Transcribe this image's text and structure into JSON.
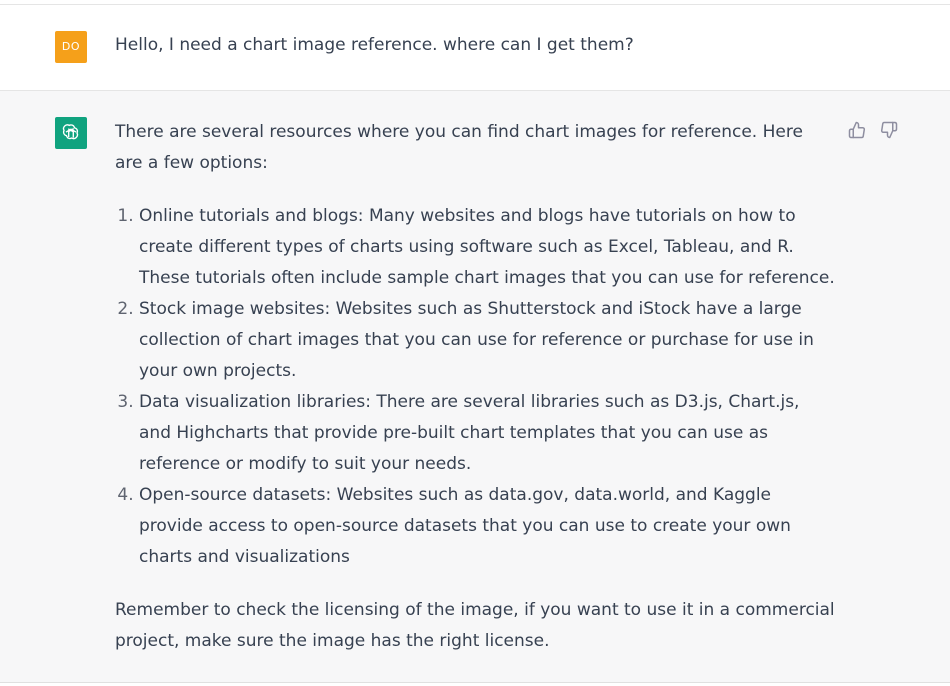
{
  "user_message": {
    "avatar_initials": "DO",
    "avatar_color": "#f5a01a",
    "text": "Hello, I need a chart image reference. where can I get them?"
  },
  "assistant_message": {
    "avatar_icon": "openai-logo-icon",
    "avatar_color": "#10a37f",
    "intro": "There are several resources where you can find chart images for reference. Here are a few options:",
    "items": [
      "Online tutorials and blogs: Many websites and blogs have tutorials on how to create different types of charts using software such as Excel, Tableau, and R. These tutorials often include sample chart images that you can use for reference.",
      "Stock image websites: Websites such as Shutterstock and iStock have a large collection of chart images that you can use for reference or purchase for use in your own projects.",
      "Data visualization libraries: There are several libraries such as D3.js, Chart.js, and Highcharts that provide pre-built chart templates that you can use as reference or modify to suit your needs.",
      "Open-source datasets: Websites such as data.gov, data.world, and Kaggle provide access to open-source datasets that you can use to create your own charts and visualizations"
    ],
    "closing": "Remember to check the licensing of the image, if you want to use it in a commercial project, make sure the image has the right license."
  },
  "feedback": {
    "thumbs_up_icon": "thumbs-up-icon",
    "thumbs_down_icon": "thumbs-down-icon"
  }
}
